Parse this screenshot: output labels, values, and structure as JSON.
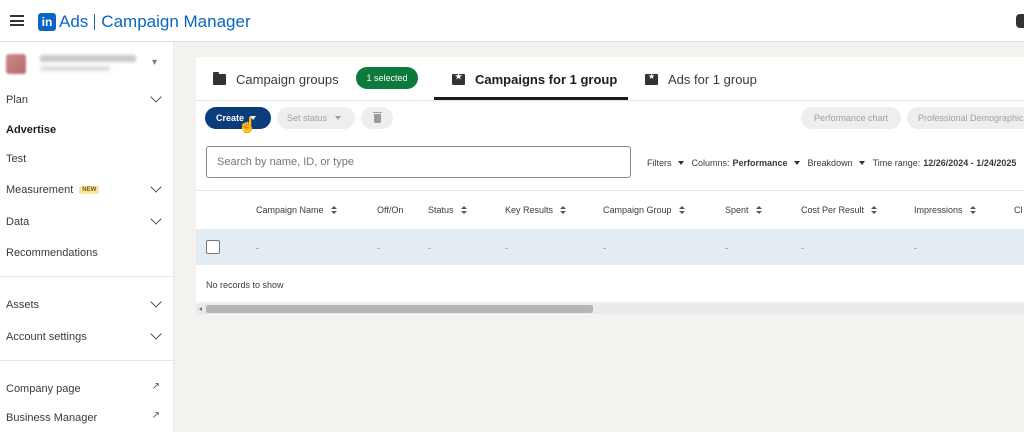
{
  "header": {
    "brand_logo": "in",
    "brand_ads": "Ads",
    "brand_product": "Campaign Manager"
  },
  "sidebar": {
    "items": [
      {
        "label": "Plan"
      },
      {
        "label": "Advertise"
      },
      {
        "label": "Test"
      },
      {
        "label": "Measurement",
        "badge": "NEW"
      },
      {
        "label": "Data"
      },
      {
        "label": "Recommendations"
      },
      {
        "label": "Assets"
      },
      {
        "label": "Account settings"
      },
      {
        "label": "Company page"
      },
      {
        "label": "Business Manager"
      }
    ]
  },
  "tabs": {
    "campaign_groups": "Campaign groups",
    "selected_pill": "1 selected",
    "campaigns": "Campaigns for 1 group",
    "ads": "Ads for 1 group"
  },
  "toolbar": {
    "create": "Create",
    "set_status": "Set status",
    "performance_chart": "Performance chart",
    "professional_demographics": "Professional Demographics"
  },
  "search": {
    "placeholder": "Search by name, ID, or type"
  },
  "filters": {
    "filters_label": "Filters",
    "columns_label": "Columns:",
    "columns_value": "Performance",
    "breakdown_label": "Breakdown",
    "time_range_label": "Time range:",
    "time_range_value": "12/26/2024 - 1/24/2025"
  },
  "table": {
    "columns": [
      "Campaign Name",
      "Off/On",
      "Status",
      "Key Results",
      "Campaign Group",
      "Spent",
      "Cost Per Result",
      "Impressions",
      "Cl"
    ],
    "row": [
      "-",
      "-",
      "-",
      "-",
      "-",
      "-",
      "-",
      "-"
    ],
    "empty_message": "No records to show"
  }
}
